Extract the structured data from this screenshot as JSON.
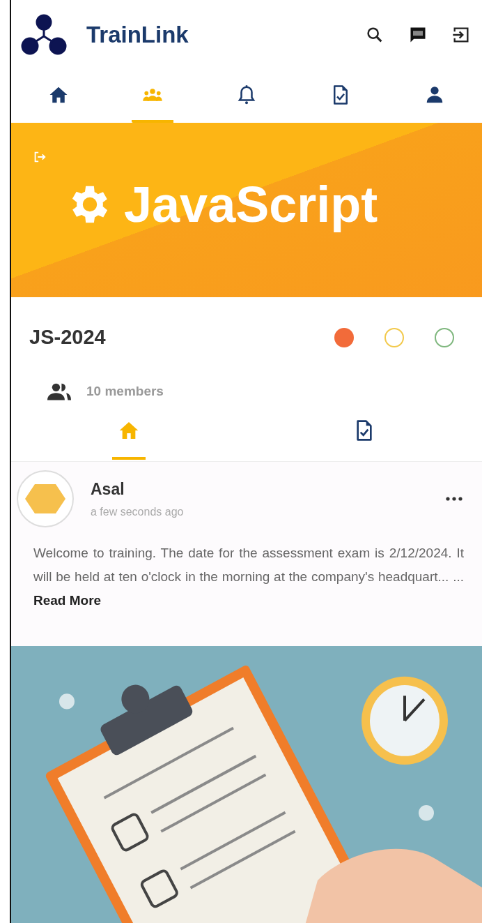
{
  "app_bar": {
    "title": "TrainLink"
  },
  "nav_tabs": [
    {
      "kind": "home",
      "selected": false
    },
    {
      "kind": "group",
      "selected": true
    },
    {
      "kind": "bell",
      "selected": false
    },
    {
      "kind": "doc-check",
      "selected": false
    },
    {
      "kind": "person",
      "selected": false
    }
  ],
  "banner": {
    "title": "JavaScript"
  },
  "group": {
    "code": "JS-2024",
    "members": "**10** members",
    "status_dots": [
      {
        "color": "#f26b3a",
        "selected": true
      },
      {
        "color": "#f2c94c",
        "selected": false
      },
      {
        "color": "#7fb77e",
        "selected": false
      }
    ]
  },
  "sub_tabs": [
    {
      "kind": "home",
      "selected": true
    },
    {
      "kind": "doc-check",
      "selected": false
    }
  ],
  "post": {
    "author": "Asal",
    "time": "a few seconds ago",
    "body": "Welcome to training. The date for the assessment exam is 2/12/2024. It will be held at ten o'clock in the morning at the company's headquart... ...",
    "read_more": "Read More"
  }
}
